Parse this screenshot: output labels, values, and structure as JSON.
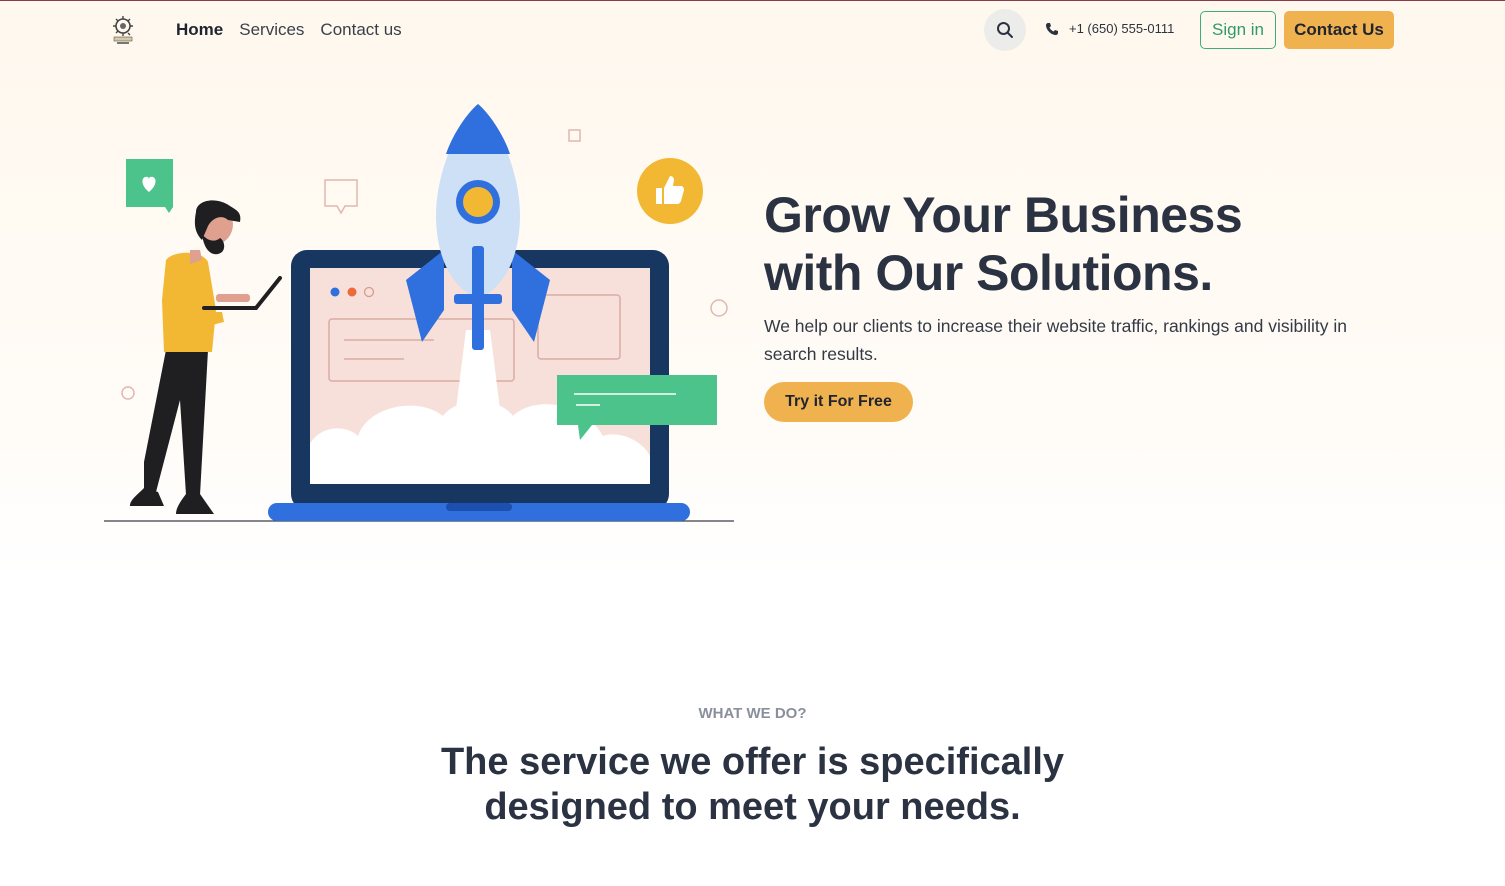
{
  "nav": {
    "items": [
      {
        "label": "Home",
        "active": true
      },
      {
        "label": "Services",
        "active": false
      },
      {
        "label": "Contact us",
        "active": false
      }
    ]
  },
  "header": {
    "phone": "+1 (650) 555-0111",
    "signin_label": "Sign in",
    "contact_label": "Contact Us",
    "icons": {
      "search": "search-icon",
      "phone": "phone-icon",
      "logo": "logo-icon"
    }
  },
  "hero": {
    "title_line1": "Grow Your Business",
    "title_line2": "with Our Solutions.",
    "text": "We help our clients to increase their website traffic, rankings and visibility in search results.",
    "cta_label": "Try it For Free"
  },
  "services": {
    "eyebrow": "WHAT WE DO?",
    "title_line1": "The service we offer is specifically",
    "title_line2": "designed to meet your needs."
  },
  "colors": {
    "accent": "#efb24f",
    "green": "#3fae7e",
    "dark_text": "#2b3242"
  }
}
